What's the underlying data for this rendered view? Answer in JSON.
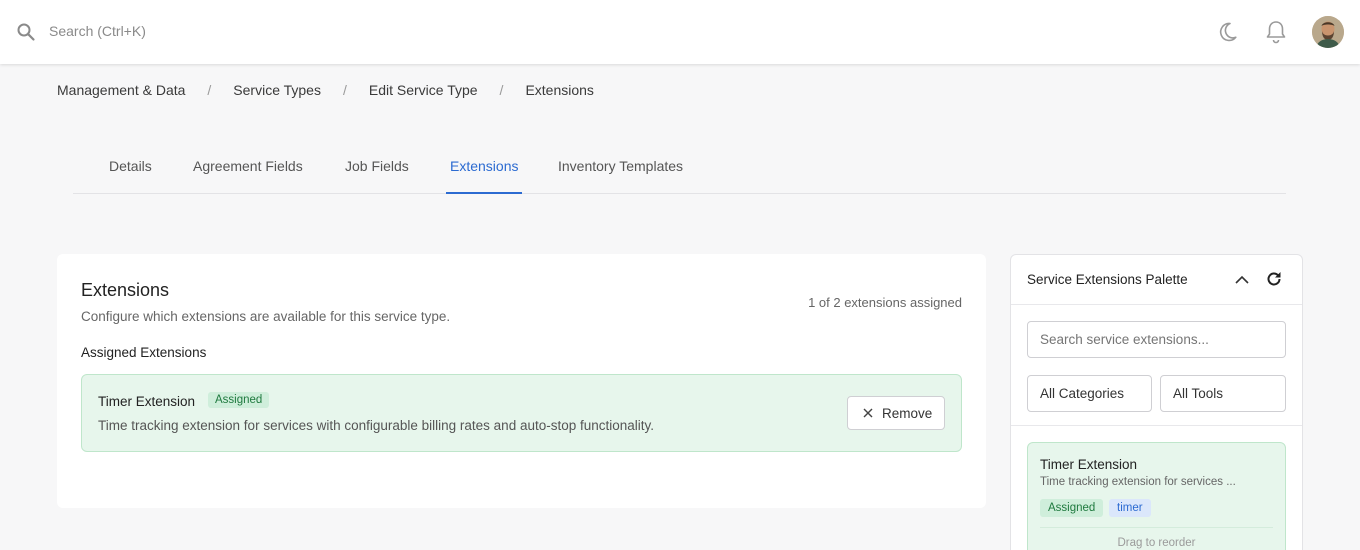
{
  "topbar": {
    "search_placeholder": "Search (Ctrl+K)",
    "icons": [
      "search-icon",
      "moon-icon",
      "bell-icon"
    ]
  },
  "breadcrumb": [
    "Management & Data",
    "Service Types",
    "Edit Service Type",
    "Extensions"
  ],
  "tabs": [
    {
      "label": "Details",
      "active": false
    },
    {
      "label": "Agreement Fields",
      "active": false
    },
    {
      "label": "Job Fields",
      "active": false
    },
    {
      "label": "Extensions",
      "active": true
    },
    {
      "label": "Inventory Templates",
      "active": false
    }
  ],
  "main": {
    "title": "Extensions",
    "subtitle": "Configure which extensions are available for this service type.",
    "count_text": "1 of 2 extensions assigned",
    "assigned_heading": "Assigned Extensions",
    "assigned": [
      {
        "name": "Timer Extension",
        "badge": "Assigned",
        "description": "Time tracking extension for services with configurable billing rates and auto-stop functionality.",
        "remove_label": "Remove"
      }
    ]
  },
  "palette": {
    "title": "Service Extensions Palette",
    "search_placeholder": "Search service extensions...",
    "category_filter": "All Categories",
    "tool_filter": "All Tools",
    "items": [
      {
        "name": "Timer Extension",
        "description": "Time tracking extension for services ...",
        "tags": [
          "Assigned",
          "timer"
        ],
        "hint": "Drag to reorder"
      }
    ]
  },
  "colors": {
    "accent": "#2c6bd1",
    "assigned_bg": "#e7f6ec",
    "assigned_border": "#bfe6cb",
    "assigned_text": "#1f7a3f"
  }
}
